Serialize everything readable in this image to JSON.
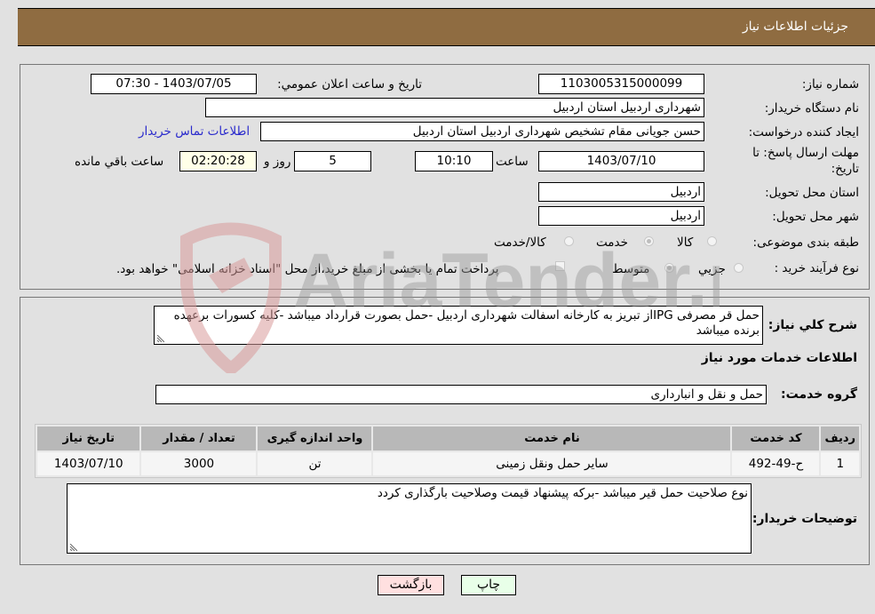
{
  "header": {
    "title": "جزئیات اطلاعات نیاز"
  },
  "form": {
    "need_number": {
      "label": "شماره نیاز:",
      "value": "1103005315000099"
    },
    "announce_datetime": {
      "label": "تاریخ و ساعت اعلان عمومي:",
      "value": "1403/07/05 - 07:30"
    },
    "buyer_org": {
      "label": "نام دستگاه خریدار:",
      "value": "شهرداری اردبیل استان اردبیل"
    },
    "requester": {
      "label": "ایجاد کننده درخواست:",
      "value": "حسن جویانی مقام تشخیص شهرداری اردبیل استان اردبیل"
    },
    "contact_link": "اطلاعات تماس خریدار",
    "deadline": {
      "label_line1": "مهلت ارسال پاسخ: تا",
      "label_line2": "تاریخ:",
      "date": "1403/07/10",
      "time_label": "ساعت",
      "time": "10:10",
      "days": "5",
      "days_label": "روز و",
      "remaining": "02:20:28",
      "remaining_label": "ساعت باقي مانده"
    },
    "delivery_province": {
      "label": "استان محل تحویل:",
      "value": "اردبیل"
    },
    "delivery_city": {
      "label": "شهر محل تحویل:",
      "value": "اردبیل"
    },
    "category": {
      "label": "طبقه بندی موضوعی:",
      "options": [
        "کالا",
        "خدمت",
        "کالا/خدمت"
      ],
      "selected": "خدمت"
    },
    "process_type": {
      "label": "نوع فرآیند خرید :",
      "options": [
        "جزيي",
        "متوسط"
      ],
      "selected": "متوسط",
      "treasury_checkbox_label": "پرداخت تمام یا بخشی از مبلغ خرید،از محل \"اسناد خزانه اسلامی\" خواهد بود."
    }
  },
  "description": {
    "label": "شرح کلي نياز:",
    "value": "حمل قر مصرفی IPGاز تبریز به کارخانه اسفالت شهرداری اردبیل -حمل بصورت قرارداد میباشد -کلیه کسورات برعهده برنده میباشد"
  },
  "services_section": {
    "title": "اطلاعات خدمات مورد نیاز",
    "group_label": "گروه خدمت:",
    "group_value": "حمل و نقل و انبارداری",
    "table": {
      "columns": [
        "ردیف",
        "کد خدمت",
        "نام خدمت",
        "واحد اندازه گیری",
        "تعداد / مقدار",
        "تاریخ نیاز"
      ],
      "rows": [
        [
          "1",
          "ح-49-492",
          "سایر حمل ونقل زمینی",
          "تن",
          "3000",
          "1403/07/10"
        ]
      ]
    }
  },
  "buyer_notes": {
    "label": "توضیحات خریدار:",
    "value": "نوع صلاحیت حمل قیر میباشد -برکه پیشنهاد قیمت وصلاحیت بارگذاری کردد"
  },
  "buttons": {
    "print": "چاپ",
    "back": "بازگشت"
  },
  "watermark": {
    "text": "AriaTender.neT"
  }
}
